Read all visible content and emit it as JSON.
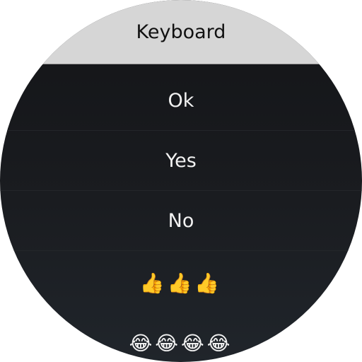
{
  "header": {
    "title": "Keyboard"
  },
  "replies": [
    {
      "label": "Ok"
    },
    {
      "label": "Yes"
    },
    {
      "label": "No"
    },
    {
      "label": "👍👍👍"
    },
    {
      "label": "😂😂😂😂"
    }
  ],
  "colors": {
    "header_bg": "#d6d6d6",
    "list_bg": "#131417",
    "text": "#f2f2f2"
  }
}
